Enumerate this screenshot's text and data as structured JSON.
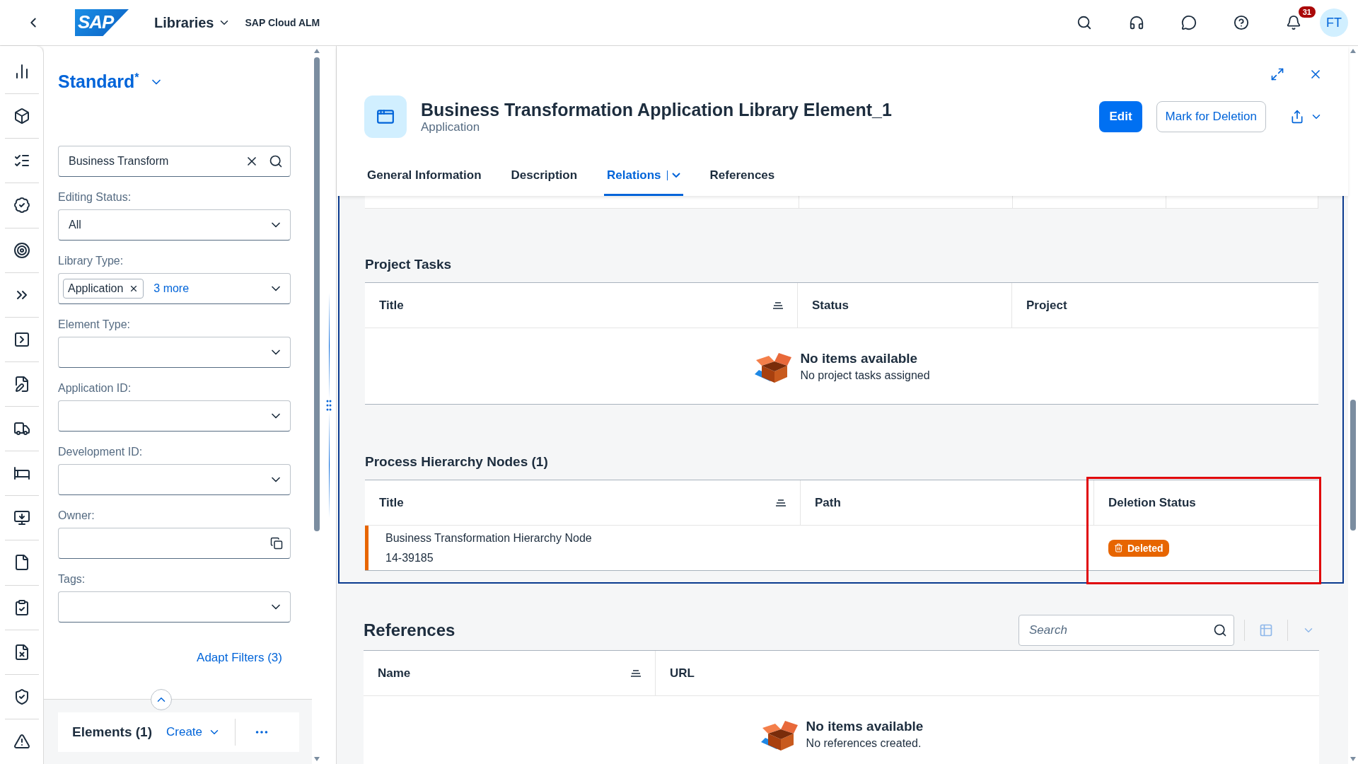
{
  "shell": {
    "logo": "SAP",
    "app": "Libraries",
    "product": "SAP Cloud ALM",
    "notifications": "31",
    "avatar": "FT"
  },
  "filter": {
    "variant": "Standard",
    "modified": "*",
    "search": "Business Transform",
    "fields": [
      {
        "kind": "select",
        "label": "Editing Status:",
        "value": "All"
      },
      {
        "kind": "tokens",
        "label": "Library Type:",
        "tokens": [
          "Application"
        ],
        "more": "3 more"
      },
      {
        "kind": "select",
        "label": "Element Type:"
      },
      {
        "kind": "select",
        "label": "Application ID:"
      },
      {
        "kind": "select",
        "label": "Development ID:"
      },
      {
        "kind": "valuehelp",
        "label": "Owner:"
      },
      {
        "kind": "select",
        "label": "Tags:"
      }
    ],
    "adapt": "Adapt Filters (3)",
    "list_title": "Elements (1)",
    "create": "Create"
  },
  "object": {
    "title": "Business Transformation Application Library Element_1",
    "subtitle": "Application",
    "edit": "Edit",
    "delete": "Mark for Deletion",
    "tabs": [
      {
        "label": "General Information",
        "selected": false
      },
      {
        "label": "Description",
        "selected": false
      },
      {
        "label": "Relations",
        "selected": true,
        "menu": true
      },
      {
        "label": "References",
        "selected": false
      }
    ]
  },
  "project_tasks": {
    "title": "Project Tasks",
    "columns": [
      {
        "label": "Title",
        "sortable": true
      },
      {
        "label": "Status",
        "sortable": false
      },
      {
        "label": "Project",
        "sortable": false
      }
    ],
    "empty_title": "No items available",
    "empty_text": "No project tasks assigned"
  },
  "hierarchy": {
    "title": "Process Hierarchy Nodes (1)",
    "columns": [
      {
        "label": "Title",
        "sortable": true,
        "highlighted": false
      },
      {
        "label": "Path",
        "sortable": false,
        "highlighted": false
      },
      {
        "label": "Deletion Status",
        "sortable": false,
        "highlighted": true
      }
    ],
    "rows": [
      {
        "title": "Business Transformation Hierarchy Node",
        "id": "14-39185",
        "flagged": true,
        "status": "Deleted"
      }
    ]
  },
  "references": {
    "title": "References",
    "search_placeholder": "Search",
    "columns": [
      {
        "label": "Name",
        "sortable": true
      },
      {
        "label": "URL",
        "sortable": false
      }
    ],
    "empty_title": "No items available",
    "empty_text": "No references created."
  }
}
